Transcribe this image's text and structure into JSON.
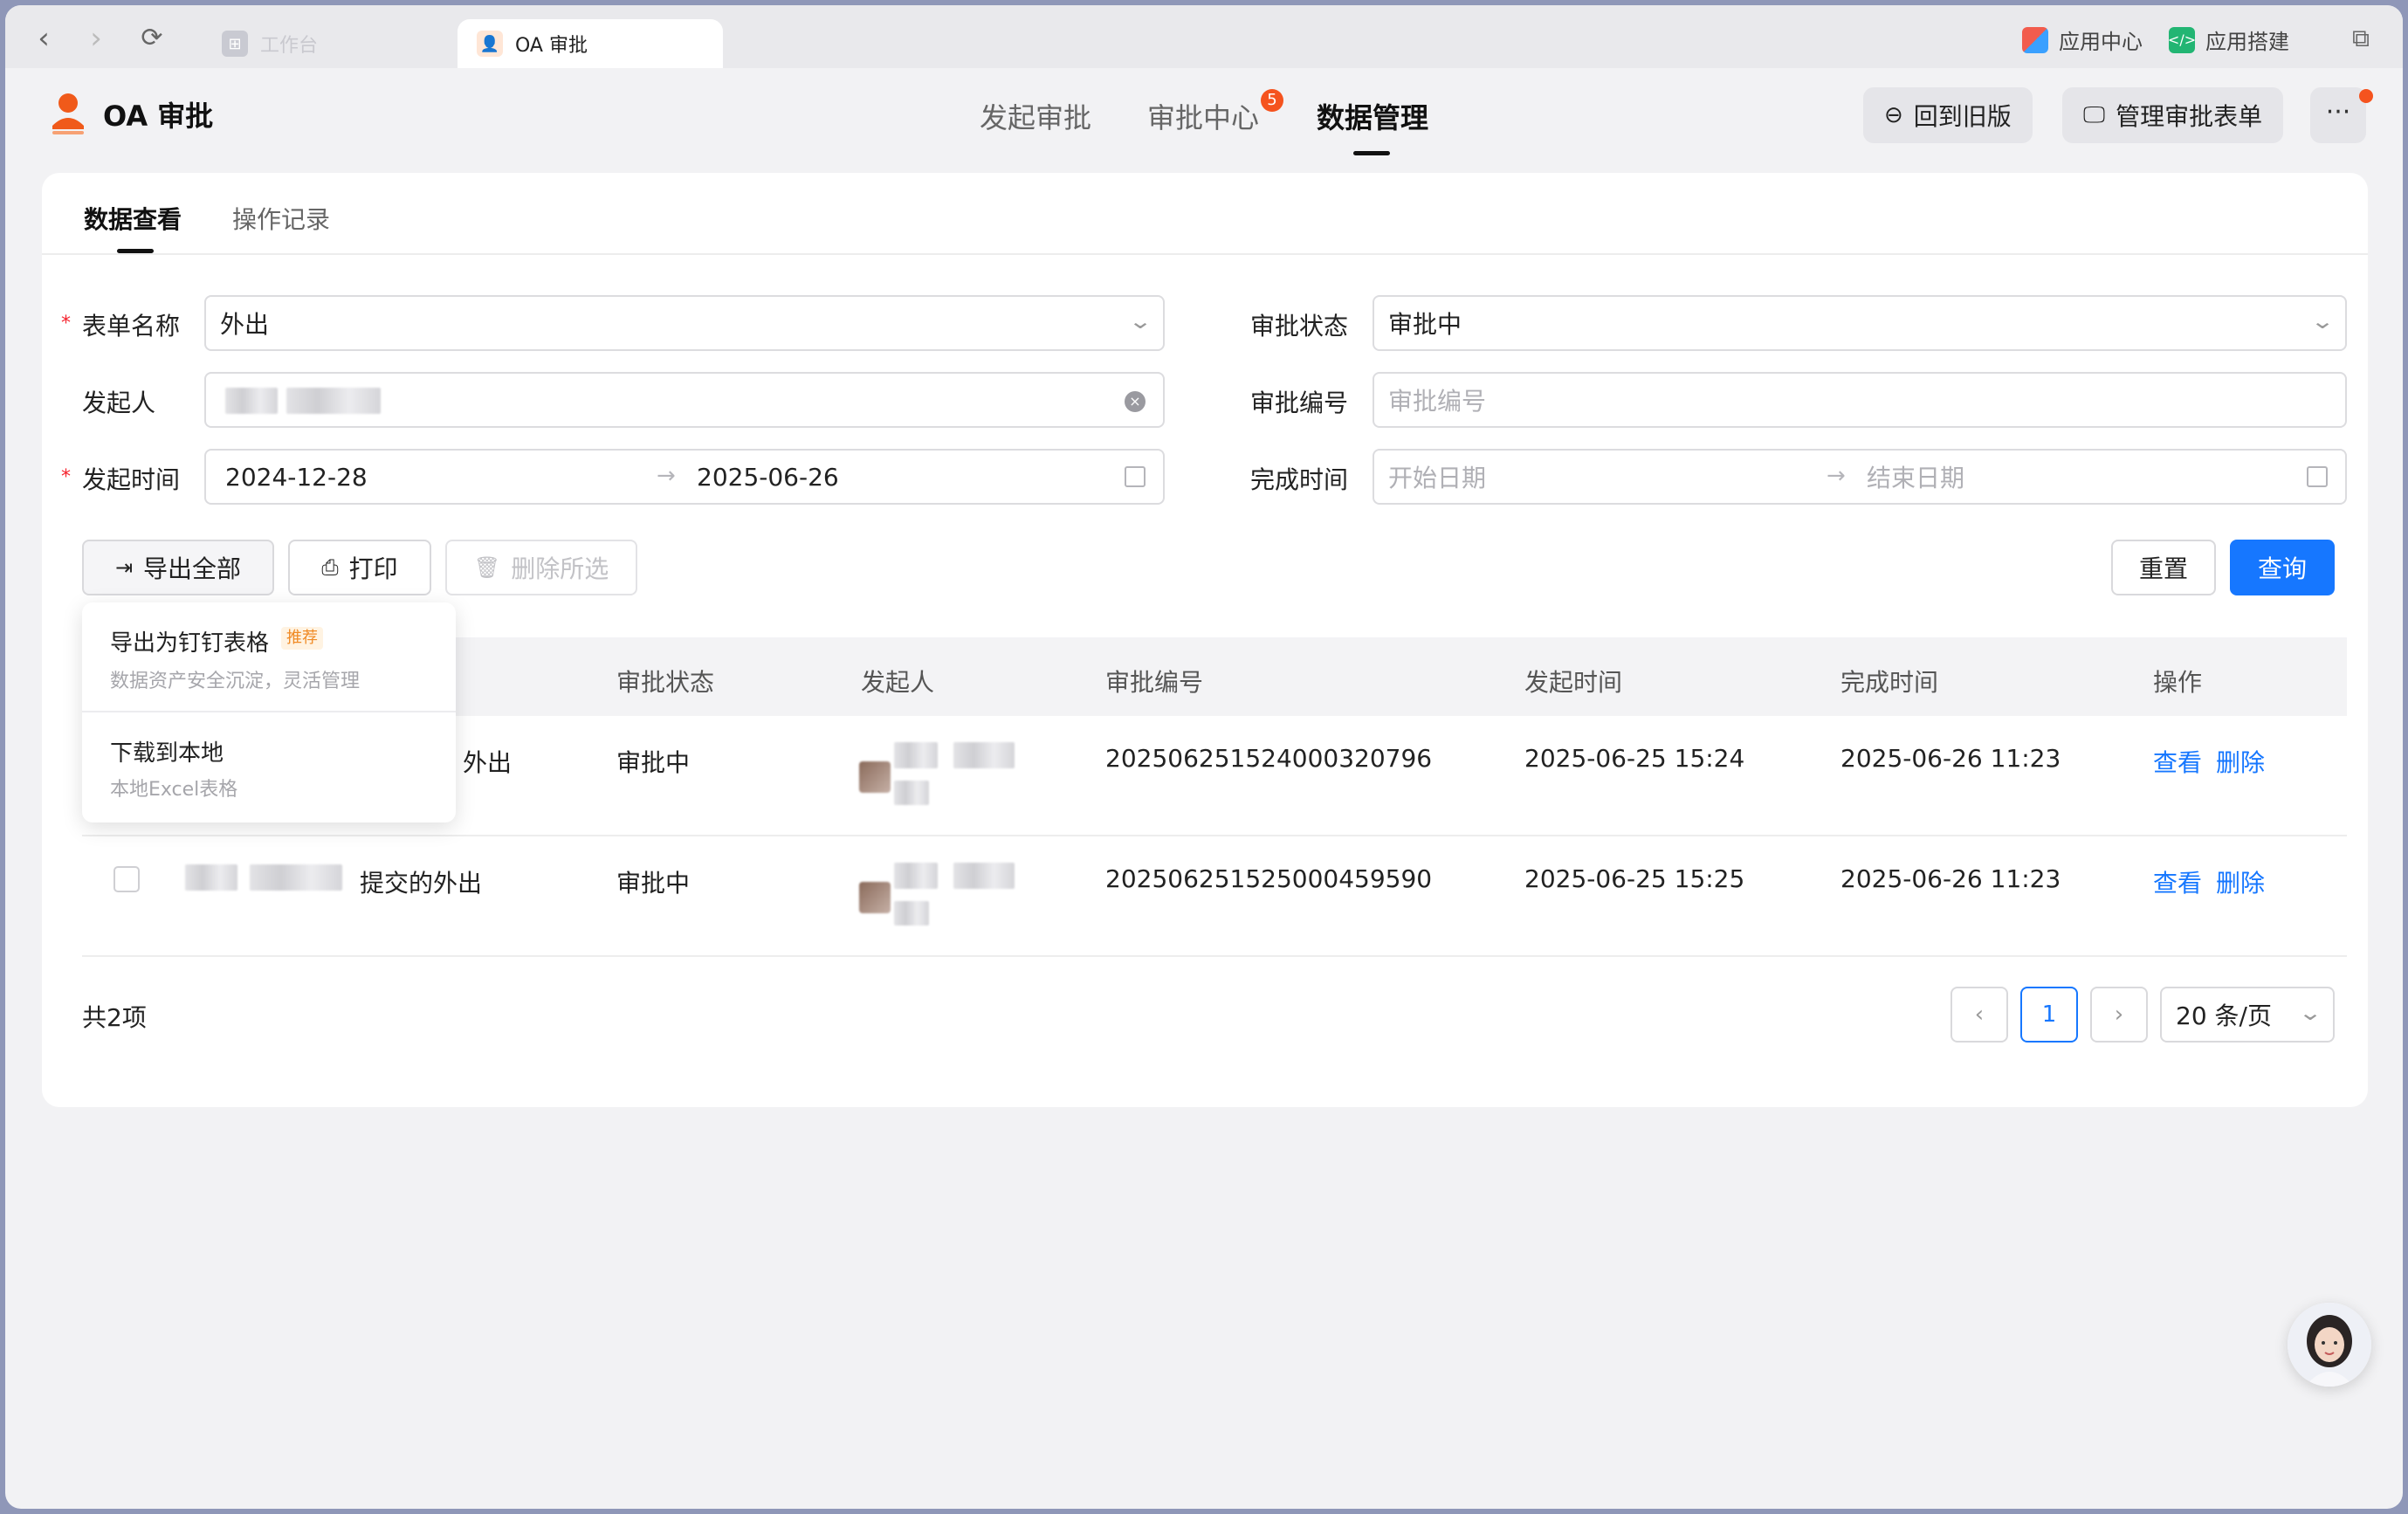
{
  "browser": {
    "tabs": [
      {
        "label": "工作台",
        "active": false
      },
      {
        "label": "OA 审批",
        "active": true
      }
    ],
    "right_links": [
      {
        "label": "应用中心",
        "icon": "app-grid-icon"
      },
      {
        "label": "应用搭建",
        "icon": "code-box-icon"
      }
    ]
  },
  "app": {
    "title": "OA 审批",
    "nav": [
      {
        "label": "发起审批"
      },
      {
        "label": "审批中心",
        "badge": "5"
      },
      {
        "label": "数据管理",
        "active": true
      }
    ],
    "buttons": {
      "old_version": "回到旧版",
      "manage_forms": "管理审批表单",
      "more": "···"
    }
  },
  "subtabs": [
    {
      "label": "数据查看",
      "active": true
    },
    {
      "label": "操作记录"
    }
  ],
  "filters": {
    "form_name": {
      "label": "表单名称",
      "value": "外出",
      "required": true
    },
    "approval_status": {
      "label": "审批状态",
      "value": "审批中"
    },
    "initiator": {
      "label": "发起人"
    },
    "approval_no": {
      "label": "审批编号",
      "placeholder": "审批编号"
    },
    "start_time": {
      "label": "发起时间",
      "from": "2024-12-28",
      "to": "2025-06-26",
      "required": true
    },
    "finish_time": {
      "label": "完成时间",
      "from_placeholder": "开始日期",
      "to_placeholder": "结束日期"
    }
  },
  "actions": {
    "export_all": "导出全部",
    "print": "打印",
    "delete_selected": "删除所选",
    "reset": "重置",
    "query": "查询"
  },
  "export_menu": [
    {
      "title": "导出为钉钉表格",
      "tag": "推荐",
      "subtitle": "数据资产安全沉淀，灵活管理"
    },
    {
      "title": "下载到本地",
      "subtitle": "本地Excel表格"
    }
  ],
  "table": {
    "columns": [
      "审批状态",
      "发起人",
      "审批编号",
      "发起时间",
      "完成时间",
      "操作"
    ],
    "rows": [
      {
        "title": "外出",
        "status": "审批中",
        "no": "202506251524000320796",
        "start": "2025-06-25 15:24",
        "finish": "2025-06-26 11:23",
        "view": "查看",
        "delete": "删除"
      },
      {
        "title": "提交的外出",
        "status": "审批中",
        "no": "202506251525000459590",
        "start": "2025-06-25 15:25",
        "finish": "2025-06-26 11:23",
        "view": "查看",
        "delete": "删除"
      }
    ]
  },
  "pagination": {
    "total": "共2项",
    "current": "1",
    "page_size": "20 条/页"
  },
  "colors": {
    "primary": "#1677ff",
    "badge": "#f5531e",
    "logo": "#f05a1a"
  }
}
